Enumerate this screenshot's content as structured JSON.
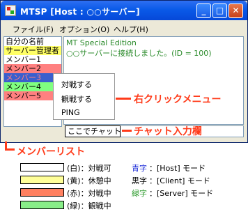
{
  "window": {
    "title": "MTSP  [Host : ○○サーバー]",
    "buttons": {
      "minimize": "_",
      "maximize": "□",
      "close": "✕"
    }
  },
  "menu": [
    "ファイル(F)",
    "オプション(O)",
    "ヘルプ(H)"
  ],
  "members": [
    {
      "name": "自分の名前",
      "color": "white"
    },
    {
      "name": "サーバー管理者",
      "color": "yellow"
    },
    {
      "name": "メンバー1",
      "color": "white"
    },
    {
      "name": "メンバー2",
      "color": "red"
    },
    {
      "name": "メンバー3",
      "color": "selected"
    },
    {
      "name": "メンバー4",
      "color": "green"
    },
    {
      "name": "メンバー5",
      "color": "red"
    }
  ],
  "chat": {
    "lines": [
      "MT Special Edition",
      "○○サーバーに接続しました。(ID = 100)"
    ],
    "input_value": "ここでチャットする"
  },
  "context_menu": [
    "対戦する",
    "観戦する",
    "PING"
  ],
  "annotations": {
    "right_click": "右クリックメニュー",
    "chat_input": "チャット入力欄",
    "member_list": "メンバーリスト"
  },
  "legend": {
    "status": [
      {
        "label": "(白)：対戦可",
        "color": "#ffffff"
      },
      {
        "label": "(黄)：休憩中",
        "color": "#ffff99"
      },
      {
        "label": "(赤)：対戦中",
        "color": "#ff8060"
      },
      {
        "label": "(緑)：観戦中",
        "color": "#88ee88"
      }
    ],
    "modes": [
      {
        "key": "青字",
        "text": "：[Host] モード",
        "color": "#1a2ad8"
      },
      {
        "key": "黒字",
        "text": "：[Client] モード",
        "color": "#000000"
      },
      {
        "key": "緑字",
        "text": "：[Server] モード",
        "color": "#2a9a2a"
      }
    ]
  }
}
